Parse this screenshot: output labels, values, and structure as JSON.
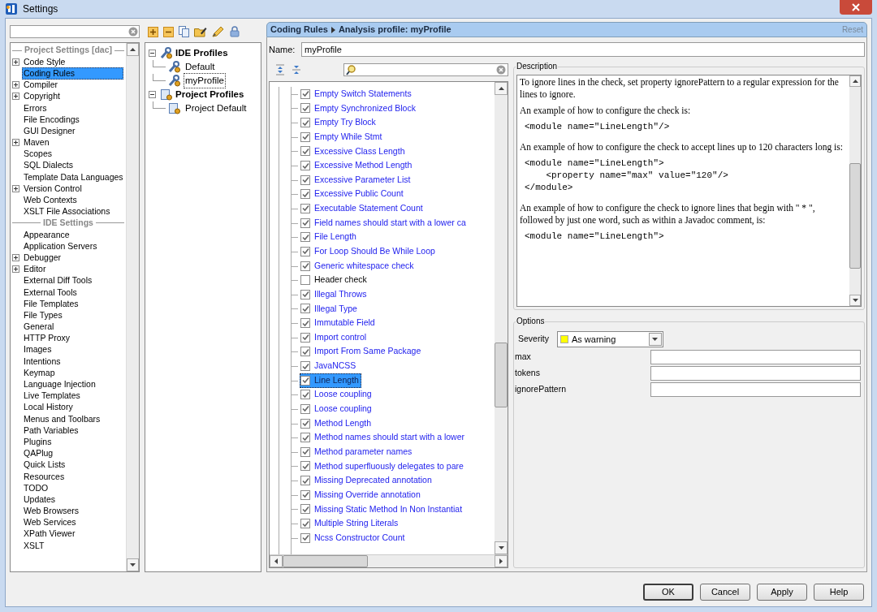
{
  "window": {
    "title": "Settings"
  },
  "sidebar": {
    "sections": [
      {
        "title": "Project Settings [dac]",
        "items": [
          {
            "label": "Code Style",
            "kind": "group",
            "selected": false
          },
          {
            "label": "Coding Rules",
            "kind": "leaf",
            "selected": true
          },
          {
            "label": "Compiler",
            "kind": "group",
            "selected": false
          },
          {
            "label": "Copyright",
            "kind": "group",
            "selected": false
          },
          {
            "label": "Errors",
            "kind": "leaf",
            "selected": false
          },
          {
            "label": "File Encodings",
            "kind": "leaf",
            "selected": false
          },
          {
            "label": "GUI Designer",
            "kind": "leaf",
            "selected": false
          },
          {
            "label": "Maven",
            "kind": "group",
            "selected": false
          },
          {
            "label": "Scopes",
            "kind": "leaf",
            "selected": false
          },
          {
            "label": "SQL Dialects",
            "kind": "leaf",
            "selected": false
          },
          {
            "label": "Template Data Languages",
            "kind": "leaf",
            "selected": false
          },
          {
            "label": "Version Control",
            "kind": "group",
            "selected": false
          },
          {
            "label": "Web Contexts",
            "kind": "leaf",
            "selected": false
          },
          {
            "label": "XSLT File Associations",
            "kind": "leaf",
            "selected": false
          }
        ]
      },
      {
        "title": "IDE Settings",
        "items": [
          {
            "label": "Appearance",
            "kind": "leaf",
            "selected": false
          },
          {
            "label": "Application Servers",
            "kind": "leaf",
            "selected": false
          },
          {
            "label": "Debugger",
            "kind": "group",
            "selected": false
          },
          {
            "label": "Editor",
            "kind": "group",
            "selected": false
          },
          {
            "label": "External Diff Tools",
            "kind": "leaf",
            "selected": false
          },
          {
            "label": "External Tools",
            "kind": "leaf",
            "selected": false
          },
          {
            "label": "File Templates",
            "kind": "leaf",
            "selected": false
          },
          {
            "label": "File Types",
            "kind": "leaf",
            "selected": false
          },
          {
            "label": "General",
            "kind": "leaf",
            "selected": false
          },
          {
            "label": "HTTP Proxy",
            "kind": "leaf",
            "selected": false
          },
          {
            "label": "Images",
            "kind": "leaf",
            "selected": false
          },
          {
            "label": "Intentions",
            "kind": "leaf",
            "selected": false
          },
          {
            "label": "Keymap",
            "kind": "leaf",
            "selected": false
          },
          {
            "label": "Language Injection",
            "kind": "leaf",
            "selected": false
          },
          {
            "label": "Live Templates",
            "kind": "leaf",
            "selected": false
          },
          {
            "label": "Local History",
            "kind": "leaf",
            "selected": false
          },
          {
            "label": "Menus and Toolbars",
            "kind": "leaf",
            "selected": false
          },
          {
            "label": "Path Variables",
            "kind": "leaf",
            "selected": false
          },
          {
            "label": "Plugins",
            "kind": "leaf",
            "selected": false
          },
          {
            "label": "QAPlug",
            "kind": "leaf",
            "selected": false
          },
          {
            "label": "Quick Lists",
            "kind": "leaf",
            "selected": false
          },
          {
            "label": "Resources",
            "kind": "leaf",
            "selected": false
          },
          {
            "label": "TODO",
            "kind": "leaf",
            "selected": false
          },
          {
            "label": "Updates",
            "kind": "leaf",
            "selected": false
          },
          {
            "label": "Web Browsers",
            "kind": "leaf",
            "selected": false
          },
          {
            "label": "Web Services",
            "kind": "leaf",
            "selected": false
          },
          {
            "label": "XPath Viewer",
            "kind": "leaf",
            "selected": false
          },
          {
            "label": "XSLT",
            "kind": "leaf",
            "selected": false
          }
        ]
      }
    ]
  },
  "profiles": {
    "tree": [
      {
        "label": "IDE Profiles",
        "expanded": true,
        "selected": false,
        "children": [
          {
            "label": "Default",
            "selected": false
          },
          {
            "label": "myProfile",
            "selected": true
          }
        ]
      },
      {
        "label": "Project Profiles",
        "expanded": true,
        "selected": false,
        "children": [
          {
            "label": "Project Default",
            "selected": false
          }
        ]
      }
    ]
  },
  "breadcrumb": [
    "Coding Rules",
    "Analysis profile: myProfile"
  ],
  "reset_link": "Reset",
  "name_field": {
    "label": "Name:",
    "value": "myProfile"
  },
  "rules": {
    "items": [
      {
        "label": "Empty Switch Statements",
        "checked": true,
        "selected": false
      },
      {
        "label": "Empty Synchronized Block",
        "checked": true,
        "selected": false
      },
      {
        "label": "Empty Try Block",
        "checked": true,
        "selected": false
      },
      {
        "label": "Empty While Stmt",
        "checked": true,
        "selected": false
      },
      {
        "label": "Excessive Class Length",
        "checked": true,
        "selected": false
      },
      {
        "label": "Excessive Method Length",
        "checked": true,
        "selected": false
      },
      {
        "label": "Excessive Parameter List",
        "checked": true,
        "selected": false
      },
      {
        "label": "Excessive Public Count",
        "checked": true,
        "selected": false
      },
      {
        "label": "Executable Statement Count",
        "checked": true,
        "selected": false
      },
      {
        "label": "Field names should start with a lower ca",
        "checked": true,
        "selected": false
      },
      {
        "label": "File Length",
        "checked": true,
        "selected": false
      },
      {
        "label": "For Loop Should Be While Loop",
        "checked": true,
        "selected": false
      },
      {
        "label": "Generic whitespace check",
        "checked": true,
        "selected": false
      },
      {
        "label": "Header check",
        "checked": false,
        "selected": false
      },
      {
        "label": "Illegal Throws",
        "checked": true,
        "selected": false
      },
      {
        "label": "Illegal Type",
        "checked": true,
        "selected": false
      },
      {
        "label": "Immutable Field",
        "checked": true,
        "selected": false
      },
      {
        "label": "Import control",
        "checked": true,
        "selected": false
      },
      {
        "label": "Import From Same Package",
        "checked": true,
        "selected": false
      },
      {
        "label": "JavaNCSS",
        "checked": true,
        "selected": false
      },
      {
        "label": "Line Length",
        "checked": true,
        "selected": true
      },
      {
        "label": "Loose coupling",
        "checked": true,
        "selected": false
      },
      {
        "label": "Loose coupling",
        "checked": true,
        "selected": false
      },
      {
        "label": "Method Length",
        "checked": true,
        "selected": false
      },
      {
        "label": "Method names should start with a lower",
        "checked": true,
        "selected": false
      },
      {
        "label": "Method parameter names",
        "checked": true,
        "selected": false
      },
      {
        "label": "Method superfluously delegates to pare",
        "checked": true,
        "selected": false
      },
      {
        "label": "Missing Deprecated annotation",
        "checked": true,
        "selected": false
      },
      {
        "label": "Missing Override annotation",
        "checked": true,
        "selected": false
      },
      {
        "label": "Missing Static Method In Non Instantiat",
        "checked": true,
        "selected": false
      },
      {
        "label": "Multiple String Literals",
        "checked": true,
        "selected": false
      },
      {
        "label": "Ncss Constructor Count",
        "checked": true,
        "selected": false
      }
    ]
  },
  "description": {
    "title": "Description",
    "blocks": [
      {
        "kind": "text",
        "text": "To ignore lines in the check, set property ignorePattern to a regular expression for the lines to ignore."
      },
      {
        "kind": "text",
        "text": "An example of how to configure the check is:"
      },
      {
        "kind": "code",
        "lines": [
          "<module name=\"LineLength\"/>"
        ]
      },
      {
        "kind": "text",
        "text": "An example of how to configure the check to accept lines up to 120 characters long is:"
      },
      {
        "kind": "code",
        "lines": [
          "<module name=\"LineLength\">",
          "    <property name=\"max\" value=\"120\"/>",
          "</module>"
        ]
      },
      {
        "kind": "text",
        "text": "An example of how to configure the check to ignore lines that begin with \" * \", followed by just one word, such as within a Javadoc comment, is:"
      },
      {
        "kind": "code",
        "lines": [
          "<module name=\"LineLength\">"
        ]
      }
    ]
  },
  "options": {
    "title": "Options",
    "severity": {
      "label": "Severity",
      "value": "As warning",
      "color": "#ffff00"
    },
    "properties": [
      {
        "label": "max"
      },
      {
        "label": "tokens"
      },
      {
        "label": "ignorePattern"
      }
    ]
  },
  "buttons": [
    {
      "label": "OK",
      "default": true
    },
    {
      "label": "Cancel",
      "default": false
    },
    {
      "label": "Apply",
      "default": false
    },
    {
      "label": "Help",
      "default": false
    }
  ]
}
